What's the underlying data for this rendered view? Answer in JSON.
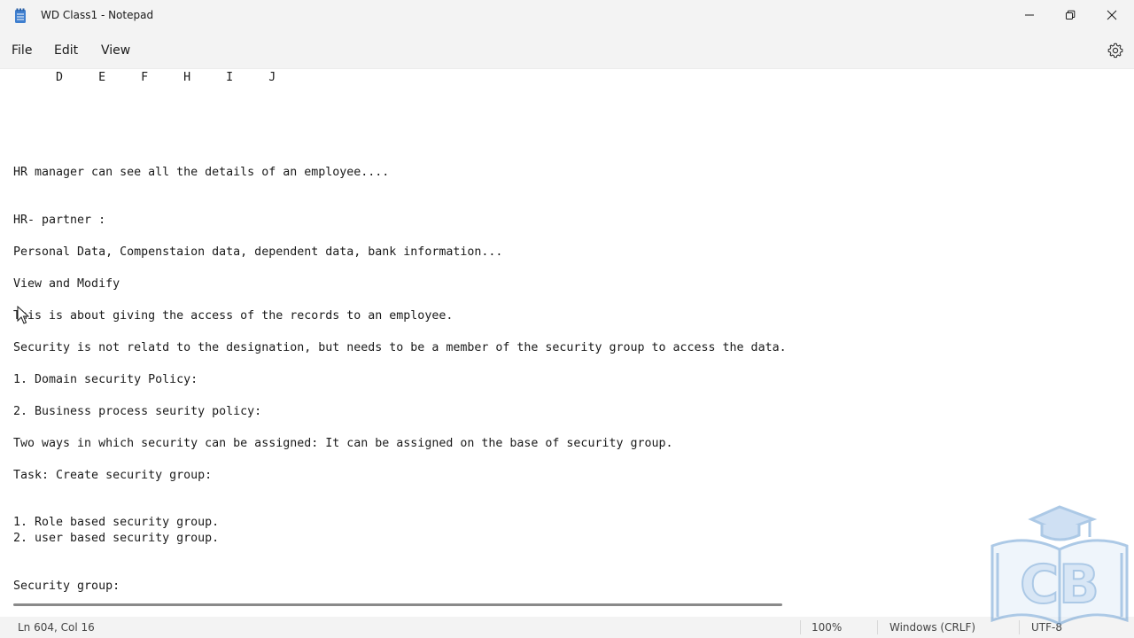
{
  "window": {
    "title": "WD Class1 - Notepad",
    "icon": "notepad-icon"
  },
  "menu": {
    "file": "File",
    "edit": "Edit",
    "view": "View"
  },
  "editor": {
    "lines": [
      "      D     E     F     H     I     J",
      "HR manager can see all the details of an employee....",
      "HR- partner :",
      "Personal Data, Compenstaion data, dependent data, bank information...",
      "View and Modify",
      "This is about giving the access of the records to an employee.",
      "Security is not relatd to the designation, but needs to be a member of the security group to access the data.",
      "1. Domain security Policy:",
      "2. Business process seurity policy:",
      "Two ways in which security can be assigned: It can be assigned on the base of security group.",
      "Task: Create security group:",
      "1. Role based security group.",
      "2. user based security group.",
      "Security group:"
    ]
  },
  "status": {
    "position": "Ln 604, Col 16",
    "zoom": "100%",
    "line_endings": "Windows (CRLF)",
    "encoding": "UTF-8"
  },
  "watermark": {
    "text": "CB"
  },
  "colors": {
    "chrome_bg": "#f3f3f3",
    "editor_bg": "#ffffff",
    "text": "#1a1a1a",
    "watermark": "#6a9ed3"
  }
}
